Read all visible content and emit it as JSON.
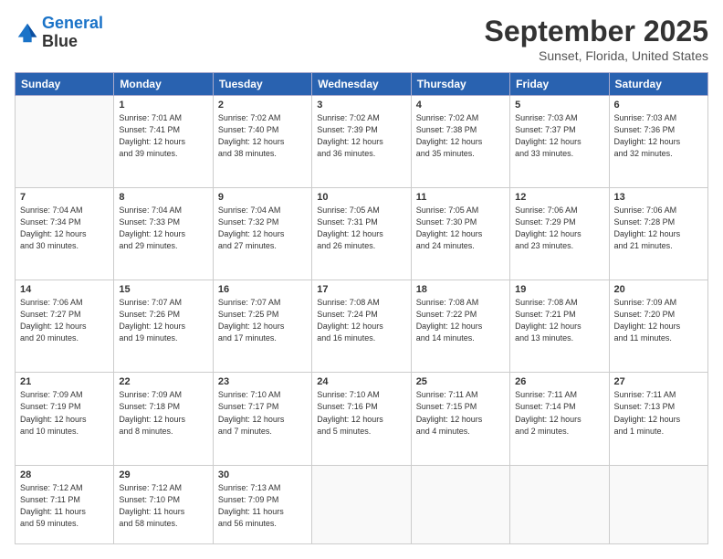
{
  "header": {
    "logo_line1": "General",
    "logo_line2": "Blue",
    "month": "September 2025",
    "location": "Sunset, Florida, United States"
  },
  "weekdays": [
    "Sunday",
    "Monday",
    "Tuesday",
    "Wednesday",
    "Thursday",
    "Friday",
    "Saturday"
  ],
  "weeks": [
    [
      {
        "day": "",
        "info": ""
      },
      {
        "day": "1",
        "info": "Sunrise: 7:01 AM\nSunset: 7:41 PM\nDaylight: 12 hours\nand 39 minutes."
      },
      {
        "day": "2",
        "info": "Sunrise: 7:02 AM\nSunset: 7:40 PM\nDaylight: 12 hours\nand 38 minutes."
      },
      {
        "day": "3",
        "info": "Sunrise: 7:02 AM\nSunset: 7:39 PM\nDaylight: 12 hours\nand 36 minutes."
      },
      {
        "day": "4",
        "info": "Sunrise: 7:02 AM\nSunset: 7:38 PM\nDaylight: 12 hours\nand 35 minutes."
      },
      {
        "day": "5",
        "info": "Sunrise: 7:03 AM\nSunset: 7:37 PM\nDaylight: 12 hours\nand 33 minutes."
      },
      {
        "day": "6",
        "info": "Sunrise: 7:03 AM\nSunset: 7:36 PM\nDaylight: 12 hours\nand 32 minutes."
      }
    ],
    [
      {
        "day": "7",
        "info": "Sunrise: 7:04 AM\nSunset: 7:34 PM\nDaylight: 12 hours\nand 30 minutes."
      },
      {
        "day": "8",
        "info": "Sunrise: 7:04 AM\nSunset: 7:33 PM\nDaylight: 12 hours\nand 29 minutes."
      },
      {
        "day": "9",
        "info": "Sunrise: 7:04 AM\nSunset: 7:32 PM\nDaylight: 12 hours\nand 27 minutes."
      },
      {
        "day": "10",
        "info": "Sunrise: 7:05 AM\nSunset: 7:31 PM\nDaylight: 12 hours\nand 26 minutes."
      },
      {
        "day": "11",
        "info": "Sunrise: 7:05 AM\nSunset: 7:30 PM\nDaylight: 12 hours\nand 24 minutes."
      },
      {
        "day": "12",
        "info": "Sunrise: 7:06 AM\nSunset: 7:29 PM\nDaylight: 12 hours\nand 23 minutes."
      },
      {
        "day": "13",
        "info": "Sunrise: 7:06 AM\nSunset: 7:28 PM\nDaylight: 12 hours\nand 21 minutes."
      }
    ],
    [
      {
        "day": "14",
        "info": "Sunrise: 7:06 AM\nSunset: 7:27 PM\nDaylight: 12 hours\nand 20 minutes."
      },
      {
        "day": "15",
        "info": "Sunrise: 7:07 AM\nSunset: 7:26 PM\nDaylight: 12 hours\nand 19 minutes."
      },
      {
        "day": "16",
        "info": "Sunrise: 7:07 AM\nSunset: 7:25 PM\nDaylight: 12 hours\nand 17 minutes."
      },
      {
        "day": "17",
        "info": "Sunrise: 7:08 AM\nSunset: 7:24 PM\nDaylight: 12 hours\nand 16 minutes."
      },
      {
        "day": "18",
        "info": "Sunrise: 7:08 AM\nSunset: 7:22 PM\nDaylight: 12 hours\nand 14 minutes."
      },
      {
        "day": "19",
        "info": "Sunrise: 7:08 AM\nSunset: 7:21 PM\nDaylight: 12 hours\nand 13 minutes."
      },
      {
        "day": "20",
        "info": "Sunrise: 7:09 AM\nSunset: 7:20 PM\nDaylight: 12 hours\nand 11 minutes."
      }
    ],
    [
      {
        "day": "21",
        "info": "Sunrise: 7:09 AM\nSunset: 7:19 PM\nDaylight: 12 hours\nand 10 minutes."
      },
      {
        "day": "22",
        "info": "Sunrise: 7:09 AM\nSunset: 7:18 PM\nDaylight: 12 hours\nand 8 minutes."
      },
      {
        "day": "23",
        "info": "Sunrise: 7:10 AM\nSunset: 7:17 PM\nDaylight: 12 hours\nand 7 minutes."
      },
      {
        "day": "24",
        "info": "Sunrise: 7:10 AM\nSunset: 7:16 PM\nDaylight: 12 hours\nand 5 minutes."
      },
      {
        "day": "25",
        "info": "Sunrise: 7:11 AM\nSunset: 7:15 PM\nDaylight: 12 hours\nand 4 minutes."
      },
      {
        "day": "26",
        "info": "Sunrise: 7:11 AM\nSunset: 7:14 PM\nDaylight: 12 hours\nand 2 minutes."
      },
      {
        "day": "27",
        "info": "Sunrise: 7:11 AM\nSunset: 7:13 PM\nDaylight: 12 hours\nand 1 minute."
      }
    ],
    [
      {
        "day": "28",
        "info": "Sunrise: 7:12 AM\nSunset: 7:11 PM\nDaylight: 11 hours\nand 59 minutes."
      },
      {
        "day": "29",
        "info": "Sunrise: 7:12 AM\nSunset: 7:10 PM\nDaylight: 11 hours\nand 58 minutes."
      },
      {
        "day": "30",
        "info": "Sunrise: 7:13 AM\nSunset: 7:09 PM\nDaylight: 11 hours\nand 56 minutes."
      },
      {
        "day": "",
        "info": ""
      },
      {
        "day": "",
        "info": ""
      },
      {
        "day": "",
        "info": ""
      },
      {
        "day": "",
        "info": ""
      }
    ]
  ]
}
